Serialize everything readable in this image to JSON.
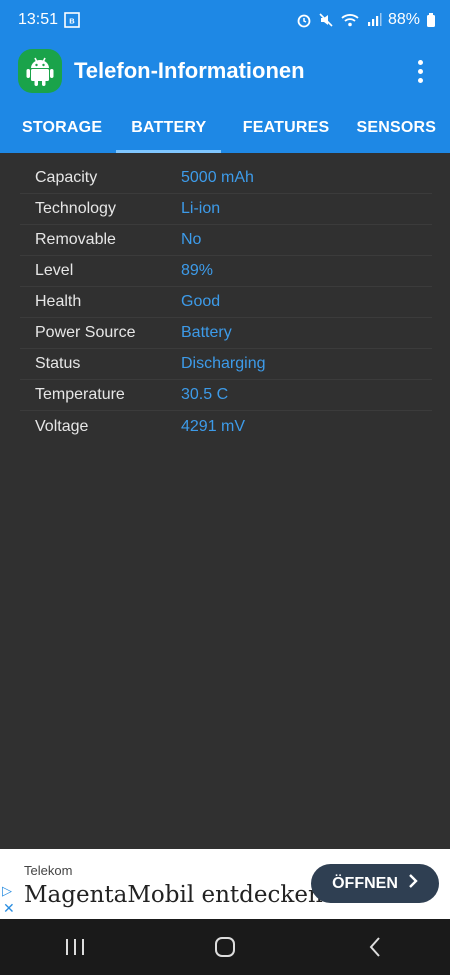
{
  "status_bar": {
    "time": "13:51",
    "battery_percent": "88%"
  },
  "app_bar": {
    "title": "Telefon-Informationen"
  },
  "tabs": [
    {
      "label": "STORAGE",
      "active": false
    },
    {
      "label": "BATTERY",
      "active": true
    },
    {
      "label": "FEATURES",
      "active": false
    },
    {
      "label": "SENSORS",
      "active": false
    }
  ],
  "battery_info": [
    {
      "label": "Capacity",
      "value": "5000 mAh"
    },
    {
      "label": "Technology",
      "value": "Li-ion"
    },
    {
      "label": "Removable",
      "value": "No"
    },
    {
      "label": "Level",
      "value": "89%"
    },
    {
      "label": "Health",
      "value": "Good"
    },
    {
      "label": "Power Source",
      "value": "Battery"
    },
    {
      "label": "Status",
      "value": "Discharging"
    },
    {
      "label": "Temperature",
      "value": "30.5 C"
    },
    {
      "label": "Voltage",
      "value": "4291 mV"
    }
  ],
  "ad": {
    "brand": "Telekom",
    "headline": "MagentaMobil entdecken",
    "button_label": "ÖFFNEN"
  },
  "colors": {
    "accent": "#1e88e5",
    "value_text": "#3d9be9",
    "background": "#303030"
  }
}
